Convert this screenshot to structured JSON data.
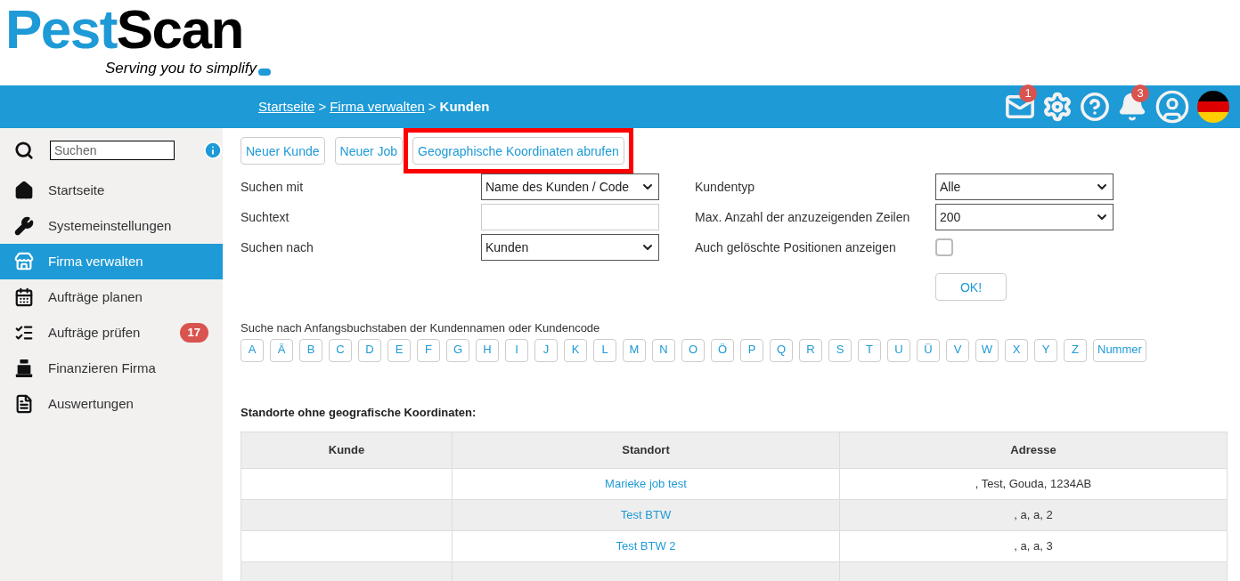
{
  "logo": {
    "part_1": "Pest",
    "part_2": "Scan",
    "tagline": "Serving you to simplify"
  },
  "breadcrumbs": [
    {
      "kind": "link",
      "label": "Startseite"
    },
    {
      "kind": "separator",
      "label": ">"
    },
    {
      "kind": "link",
      "label": "Firma verwalten"
    },
    {
      "kind": "separator",
      "label": ">"
    },
    {
      "kind": "current",
      "label": "Kunden"
    }
  ],
  "header_icons": [
    {
      "kind": "mail",
      "badge": "1"
    },
    {
      "kind": "settings"
    },
    {
      "kind": "help"
    },
    {
      "kind": "bell",
      "badge": "3"
    },
    {
      "kind": "user"
    },
    {
      "kind": "flag"
    }
  ],
  "sidebar": {
    "search": {
      "placeholder": "Suchen"
    },
    "items": [
      {
        "kind": "home",
        "label": "Startseite",
        "selected": false
      },
      {
        "kind": "wrench",
        "label": "Systemeinstellungen",
        "selected": false
      },
      {
        "kind": "store",
        "label": "Firma verwalten",
        "selected": true
      },
      {
        "kind": "calendar",
        "label": "Aufträge planen",
        "selected": false
      },
      {
        "kind": "check",
        "label": "Aufträge prüfen",
        "selected": false,
        "badge": "17"
      },
      {
        "kind": "register",
        "label": "Finanzieren Firma",
        "selected": false
      },
      {
        "kind": "report",
        "label": "Auswertungen",
        "selected": false
      }
    ]
  },
  "actions": [
    {
      "label": "Neuer Kunde",
      "highlighted": false
    },
    {
      "label": "Neuer Job",
      "highlighted": false
    },
    {
      "label": "Geographische Koordinaten abrufen",
      "highlighted": true
    }
  ],
  "filters_left": [
    {
      "label": "Suchen mit",
      "kind": "select",
      "value": "Name des Kunden / Code"
    },
    {
      "label": "Suchtext",
      "kind": "text"
    },
    {
      "label": "Suchen nach",
      "kind": "select",
      "value": "Kunden"
    }
  ],
  "filters_right": [
    {
      "label": "Kundentyp",
      "kind": "select",
      "value": "Alle"
    },
    {
      "label": "Max. Anzahl der anzuzeigenden Zeilen",
      "kind": "select",
      "value": "200"
    },
    {
      "label": "Auch gelöschte Positionen anzeigen",
      "kind": "checkbox",
      "checked": false
    }
  ],
  "ok_button": "OK!",
  "letters_title": "Suche nach Anfangsbuchstaben der Kundennamen oder Kundencode",
  "letters": [
    "A",
    "Ä",
    "B",
    "C",
    "D",
    "E",
    "F",
    "G",
    "H",
    "I",
    "J",
    "K",
    "L",
    "M",
    "N",
    "O",
    "Ö",
    "P",
    "Q",
    "R",
    "S",
    "T",
    "U",
    "Ü",
    "V",
    "W",
    "X",
    "Y",
    "Z",
    "Nummer"
  ],
  "table": {
    "title": "Standorte ohne geografische Koordinaten:",
    "columns": [
      "Kunde",
      "Standort",
      "Adresse"
    ],
    "rows": [
      {
        "kunde": "",
        "standort": "Marieke job test",
        "adresse": ", Test, Gouda, 1234AB"
      },
      {
        "kunde": "",
        "standort": "Test BTW",
        "adresse": ", a, a, 2"
      },
      {
        "kunde": "",
        "standort": "Test BTW 2",
        "adresse": ", a, a, 3"
      }
    ]
  }
}
